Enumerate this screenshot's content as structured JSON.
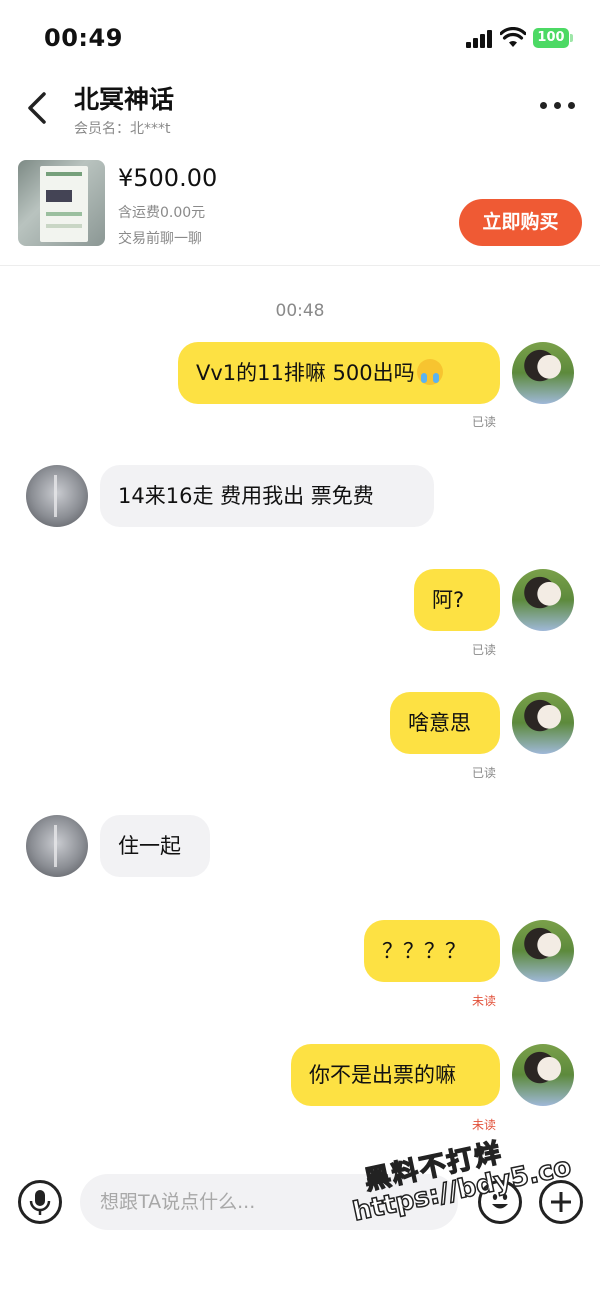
{
  "status_bar": {
    "time": "00:49",
    "battery": "100"
  },
  "header": {
    "title": "北冥神话",
    "member": "会员名：北***t"
  },
  "product": {
    "price": "¥500.00",
    "shipping": "含运费0.00元",
    "hint": "交易前聊一聊",
    "buy_label": "立即购买"
  },
  "chat": {
    "timestamp": "00:48",
    "messages": [
      {
        "side": "sent",
        "text": "Vv1的11排嘛  500出吗",
        "emoji": "crying-face",
        "status": "已读"
      },
      {
        "side": "received",
        "text": "14来16走  费用我出  票免费"
      },
      {
        "side": "sent",
        "text": "阿?",
        "status": "已读"
      },
      {
        "side": "sent",
        "text": "啥意思",
        "status": "已读"
      },
      {
        "side": "received",
        "text": "住一起"
      },
      {
        "side": "sent",
        "text": "？？？？",
        "status": "未读"
      },
      {
        "side": "sent",
        "text": "你不是出票的嘛",
        "status": "未读"
      }
    ]
  },
  "input": {
    "placeholder": "想跟TA说点什么..."
  },
  "watermark": {
    "line1": "黑料不打烊",
    "line2": "https://bdy5.co"
  },
  "colors": {
    "sent_bubble": "#fde143",
    "received_bubble": "#f2f2f4",
    "buy_button": "#ef5a34",
    "unread": "#e2513a",
    "battery": "#4cd964"
  }
}
